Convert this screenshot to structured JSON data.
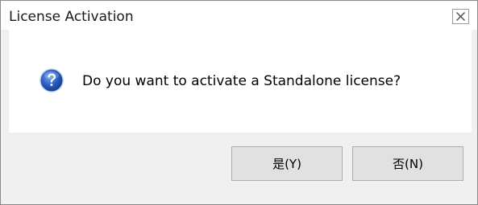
{
  "window": {
    "title": "License Activation"
  },
  "dialog": {
    "icon": "question-icon",
    "message": "Do you want to activate a Standalone license?"
  },
  "buttons": {
    "yes_label": "是(Y)",
    "no_label": "否(N)"
  },
  "colors": {
    "icon_blue": "#2a5cc0",
    "button_face": "#e1e1e1",
    "button_border": "#adadad",
    "dialog_background": "#f0f0f0"
  }
}
